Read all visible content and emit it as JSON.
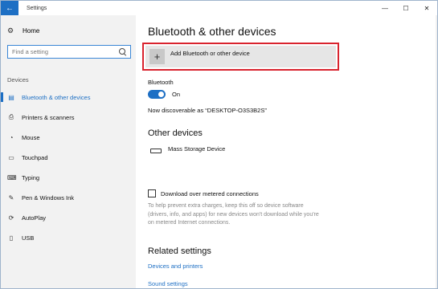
{
  "window": {
    "title": "Settings",
    "back_icon": "←",
    "minimize": "—",
    "maximize": "☐",
    "close": "✕"
  },
  "sidebar": {
    "home": {
      "label": "Home",
      "icon": "⚙"
    },
    "search_placeholder": "Find a setting",
    "section_label": "Devices",
    "items": [
      {
        "label": "Bluetooth & other devices",
        "icon": "▤",
        "active": true
      },
      {
        "label": "Printers & scanners",
        "icon": "⎙"
      },
      {
        "label": "Mouse",
        "icon": "◔"
      },
      {
        "label": "Touchpad",
        "icon": "▭"
      },
      {
        "label": "Typing",
        "icon": "⌨"
      },
      {
        "label": "Pen & Windows Ink",
        "icon": "✎"
      },
      {
        "label": "AutoPlay",
        "icon": "⟳"
      },
      {
        "label": "USB",
        "icon": "▯"
      }
    ]
  },
  "main": {
    "title": "Bluetooth & other devices",
    "add_button": {
      "icon": "+",
      "label": "Add Bluetooth or other device"
    },
    "bluetooth": {
      "label": "Bluetooth",
      "toggle_state": "On",
      "discoverable": "Now discoverable as “DESKTOP-O3S3B2S”"
    },
    "other_devices": {
      "title": "Other devices",
      "devices": [
        {
          "name": "Mass Storage Device"
        }
      ]
    },
    "metered": {
      "label": "Download over metered connections",
      "help": "To help prevent extra charges, keep this off so device software (drivers, info, and apps) for new devices won't download while you're on metered Internet connections."
    },
    "related": {
      "title": "Related settings",
      "links": [
        "Devices and printers",
        "Sound settings"
      ]
    }
  },
  "colors": {
    "accent": "#1d6fc4",
    "highlight": "#d9232e"
  }
}
